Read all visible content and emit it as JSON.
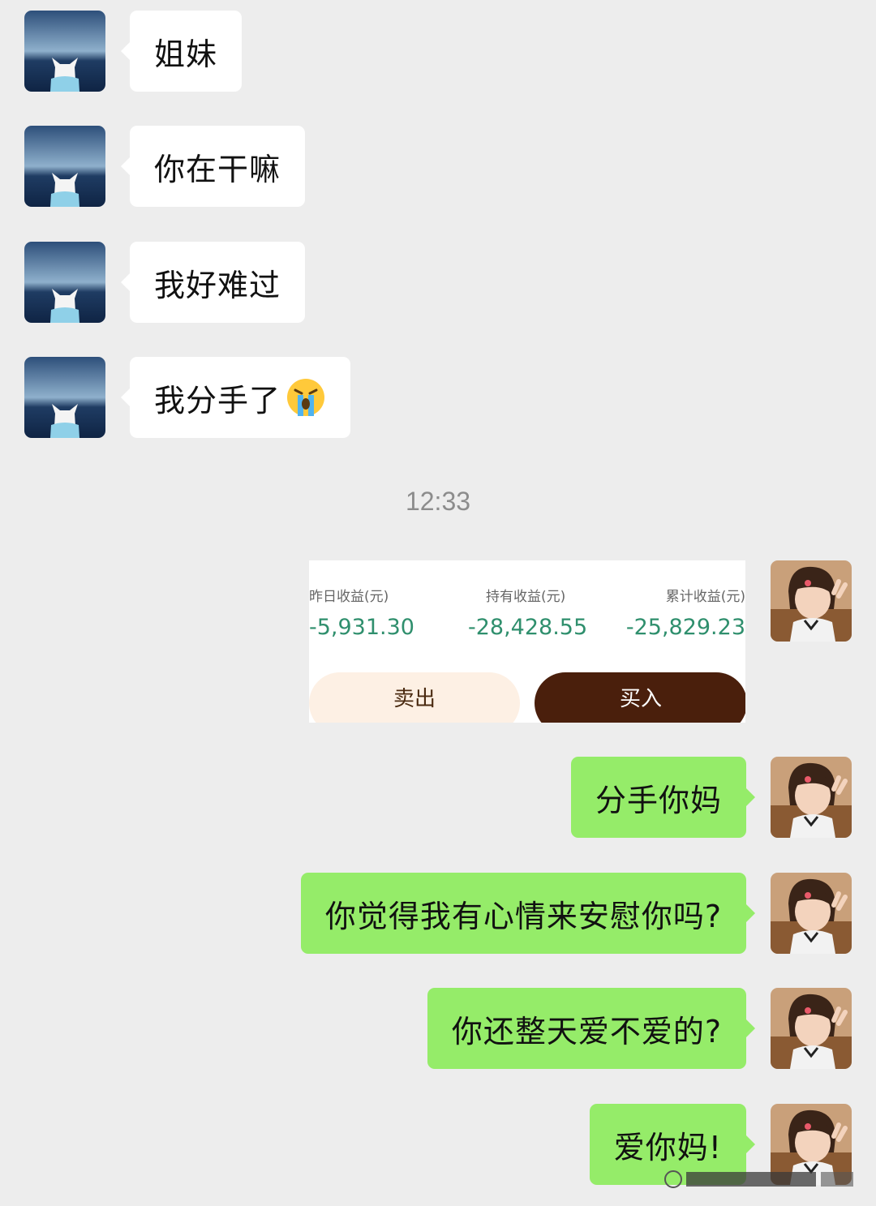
{
  "colors": {
    "background": "#ededed",
    "incoming_bubble": "#ffffff",
    "outgoing_bubble": "#95ec69",
    "fund_value": "#2f8f6d",
    "buy_button": "#4a1f0c",
    "sell_button": "#fdf0e4"
  },
  "incoming": [
    {
      "text": "姐妹"
    },
    {
      "text": "你在干嘛"
    },
    {
      "text": "我好难过"
    },
    {
      "text": "我分手了",
      "emoji": "loudly-crying-face-icon"
    }
  ],
  "timestamp": "12:33",
  "fund_card": {
    "stats": [
      {
        "label": "昨日收益(元)",
        "value": "-5,931.30"
      },
      {
        "label": "持有收益(元)",
        "value": "-28,428.55"
      },
      {
        "label": "累计收益(元)",
        "value": "-25,829.23"
      }
    ],
    "sell_label": "卖出",
    "buy_label": "买入"
  },
  "outgoing": [
    {
      "text": "分手你妈"
    },
    {
      "text": "你觉得我有心情来安慰你吗?"
    },
    {
      "text": "你还整天爱不爱的?"
    },
    {
      "text": "爱你妈!"
    }
  ]
}
